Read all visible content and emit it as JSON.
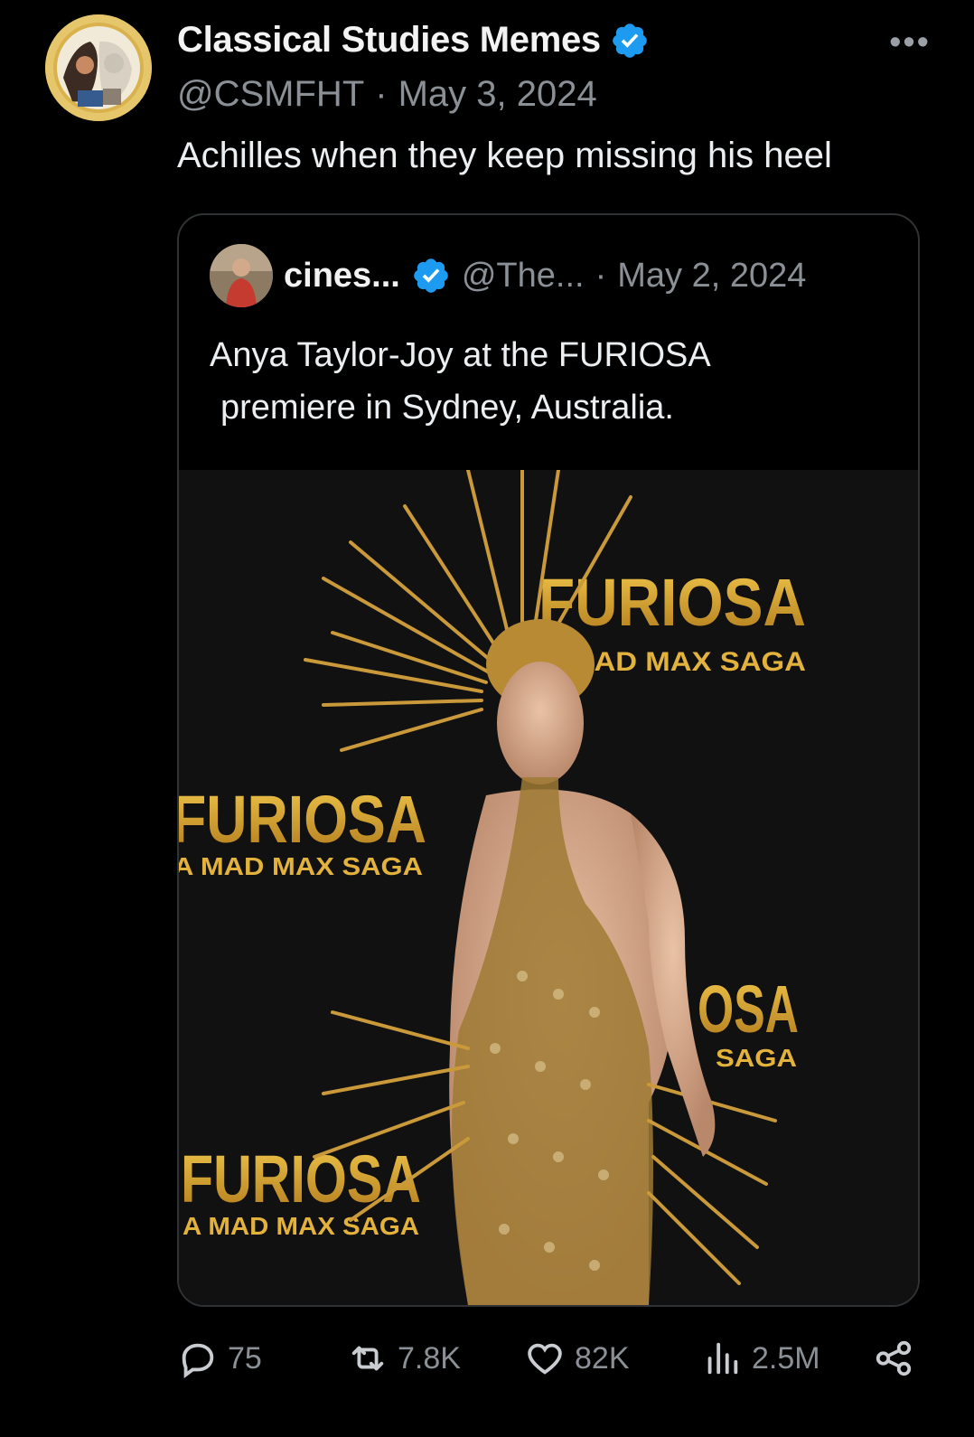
{
  "post": {
    "display_name": "Classical Studies Memes",
    "handle": "@CSMFHT",
    "separator": "·",
    "date": "May 3, 2024",
    "text": "Achilles when they keep missing his heel",
    "more_icon": "more-icon",
    "avatar_icon": "avatar-classical-art"
  },
  "quote": {
    "display_name": "cines...",
    "handle": "@The...",
    "separator": "·",
    "date": "May 2, 2024",
    "text_line1": "Anya Taylor-Joy at the FURIOSA",
    "text_line2": "premiere in Sydney, Australia.",
    "image": {
      "backdrop_title_1": "FURIOSA",
      "backdrop_sub_1": "MAD MAX SAGA",
      "backdrop_title_2": "FURIOSA",
      "backdrop_sub_2": "A MAD MAX SAGA",
      "backdrop_title_3": "OSA",
      "backdrop_sub_3": "SAGA",
      "backdrop_title_4": "FURIOSA",
      "backdrop_sub_4": "A MAD MAX SAGA"
    }
  },
  "actions": {
    "replies": "75",
    "reposts": "7.8K",
    "likes": "82K",
    "views": "2.5M"
  },
  "colors": {
    "background": "#000000",
    "text": "#e7e9ea",
    "muted": "#8b9096",
    "verified": "#1d9bf0",
    "gold": "#c8a037"
  }
}
